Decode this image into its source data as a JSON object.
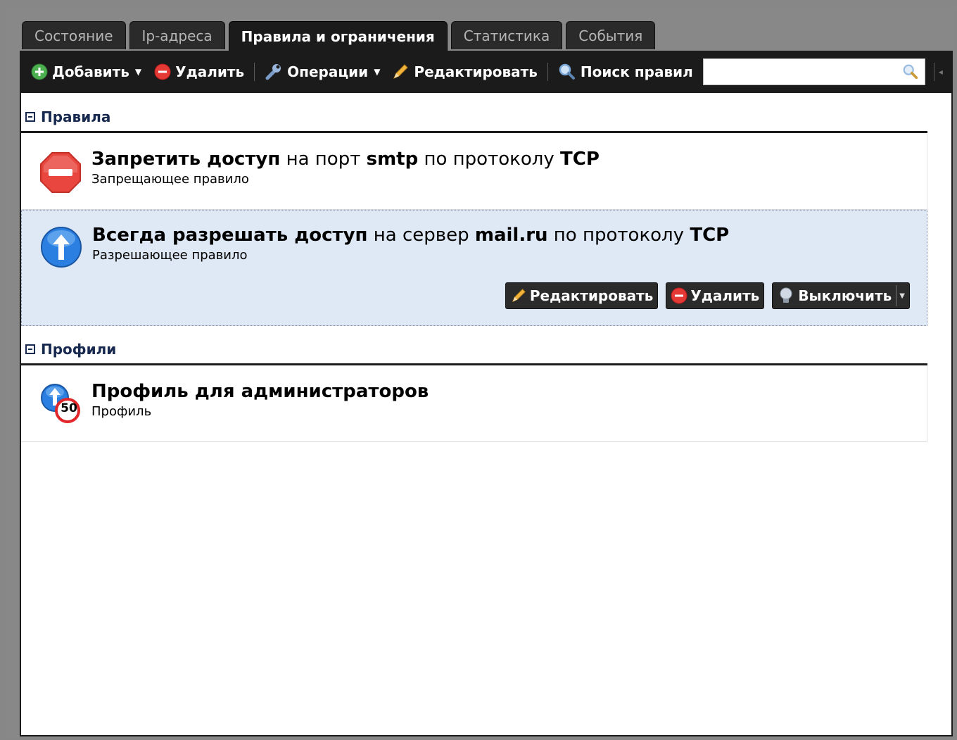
{
  "tabs": [
    {
      "label": "Состояние",
      "active": false
    },
    {
      "label": "Ip-адреса",
      "active": false
    },
    {
      "label": "Правила и ограничения",
      "active": true
    },
    {
      "label": "Статистика",
      "active": false
    },
    {
      "label": "События",
      "active": false
    }
  ],
  "toolbar": {
    "add_label": "Добавить",
    "delete_label": "Удалить",
    "operations_label": "Операции",
    "edit_label": "Редактировать",
    "search_label": "Поиск правил",
    "search_value": "",
    "search_placeholder": ""
  },
  "sections": {
    "rules": {
      "title": "Правила",
      "items": [
        {
          "icon": "deny-icon",
          "action": "Запретить доступ",
          "mid1": " на порт ",
          "target": "smtp",
          "mid2": " по протоколу ",
          "protocol": "TCP",
          "subtitle": "Запрещающее правило"
        },
        {
          "icon": "allow-icon",
          "action": "Всегда разрешать доступ",
          "mid1": " на сервер ",
          "target": "mail.ru",
          "mid2": " по протоколу ",
          "protocol": "TCP",
          "subtitle": "Разрешающее правило",
          "buttons": {
            "edit": "Редактировать",
            "delete": "Удалить",
            "disable": "Выключить"
          }
        }
      ]
    },
    "profiles": {
      "title": "Профили",
      "items": [
        {
          "icon": "profile-icon",
          "title": "Профиль для администраторов",
          "badge": "50",
          "subtitle": "Профиль"
        }
      ]
    }
  },
  "colors": {
    "toolbar_bg": "#1b1b1b",
    "selected_row": "#dfe8f5",
    "section_title": "#17294f",
    "deny_red": "#e8463f",
    "allow_blue": "#2a7fe0"
  }
}
